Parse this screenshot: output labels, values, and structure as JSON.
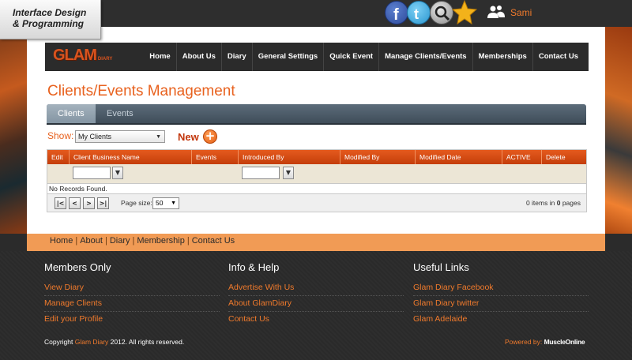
{
  "corner_label": {
    "line1": "Interface Design",
    "line2": "& Programming"
  },
  "header": {
    "username": "Sami"
  },
  "social_icons": [
    "facebook-icon",
    "twitter-icon",
    "search-icon",
    "star-icon"
  ],
  "logo": {
    "text": "GLAM",
    "small": "DIARY"
  },
  "nav": [
    "Home",
    "About Us",
    "Diary",
    "General Settings",
    "Quick Event",
    "Manage Clients/Events",
    "Memberships",
    "Contact Us"
  ],
  "page_title": "Clients/Events Management",
  "tabs": [
    {
      "label": "Clients",
      "active": true
    },
    {
      "label": "Events",
      "active": false
    }
  ],
  "show": {
    "label": "Show:",
    "selected": "My Clients"
  },
  "new_label": "New",
  "grid": {
    "columns": [
      "Edit",
      "Client Business Name",
      "Events",
      "Introduced By",
      "Modified By",
      "Modified Date",
      "ACTIVE",
      "Delete"
    ],
    "empty_text": "No Records Found.",
    "page_size_label": "Page size:",
    "page_size": "50",
    "items_count": "0",
    "pages_count": "0",
    "items_text": "items in",
    "pages_text": "pages"
  },
  "footer_nav": [
    "Home",
    "About",
    "Diary",
    "Membership",
    "Contact Us"
  ],
  "footer_cols": [
    {
      "title": "Members Only",
      "links": [
        "View Diary",
        "Manage Clients",
        "Edit your Profile"
      ]
    },
    {
      "title": "Info & Help",
      "links": [
        "Advertise With Us",
        "About GlamDiary",
        "Contact Us"
      ]
    },
    {
      "title": "Useful Links",
      "links": [
        "Glam Diary Facebook",
        "Glam Diary twitter",
        "Glam Adelaide"
      ]
    }
  ],
  "copyright": {
    "prefix": "Copyright",
    "link": "Glam Diary",
    "suffix": "2012. All rights reserved."
  },
  "powered": {
    "prefix": "Powered by:",
    "brand": "MuscleOnline"
  },
  "colors": {
    "accent": "#e8621f",
    "header_row": "#d9531e",
    "band": "#f19b55",
    "dark": "#2b2b2b"
  }
}
